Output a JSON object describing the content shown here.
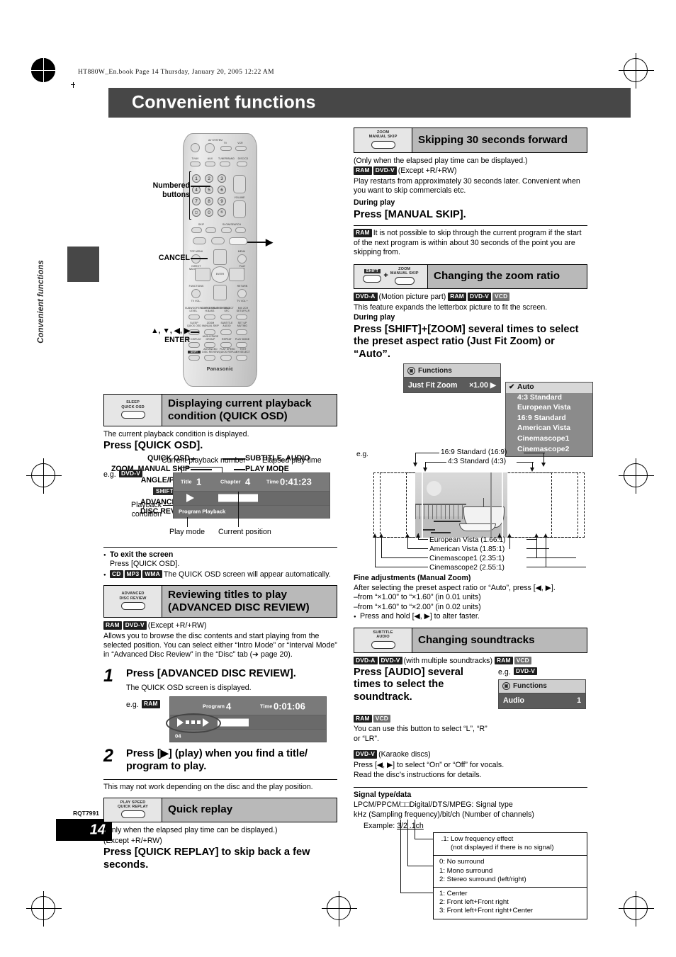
{
  "meta": {
    "book_info": "HT880W_En.book  Page 14  Thursday, January 20, 2005  12:22 AM",
    "chapter_title": "Convenient functions",
    "side_tab": "Convenient functions",
    "rqt_code": "RQT7991",
    "page_number": "14"
  },
  "remote": {
    "brand": "Panasonic",
    "callouts_left": [
      {
        "label": "Numbered\nbuttons",
        "line1": "Numbered",
        "line2": "buttons"
      },
      {
        "label": "CANCEL"
      },
      {
        "label": "▲, ▼, ◀, ▶",
        "line2": "ENTER"
      },
      {
        "label": "QUICK OSD"
      },
      {
        "label": "ZOOM, MANUAL SKIP"
      },
      {
        "label": "ANGLE/PAGE"
      },
      {
        "label": "SHIFT"
      },
      {
        "label": "ADVANCED",
        "line2": "DISC REVIEW"
      }
    ],
    "callouts_right": [
      {
        "label": "▶"
      },
      {
        "label": "SUBTITLE, AUDIO"
      },
      {
        "label": "PLAY MODE"
      },
      {
        "label": "REPEAT"
      },
      {
        "label": "PLAY SPEED,",
        "line2": "QUICK REPLAY"
      }
    ],
    "top_labels": {
      "av_system": "AV SYSTEM",
      "tv": "TV",
      "vcr": "VCR",
      "row2": [
        "TV/AV",
        "AUX",
        "TUNER/BAND",
        "DISC/CD"
      ],
      "ch": "CH",
      "volume": "VOLUME",
      "skip": "SKIP",
      "slow_search": "SLOW/SEARCH",
      "top_menu": "TOP MENU",
      "menu": "MENU",
      "direct_navigator": "DIRECT NAVIGATOR",
      "play_list": "PLAY LIST",
      "enter": "ENTER",
      "functions": "FUNCTIONS",
      "return": "RETURN",
      "tv_vol_minus": "TV VOL -",
      "tv_vol_plus": "TV VOL +"
    },
    "button_rows": [
      [
        "SUBWOOFER/SUPER SRND LEVEL",
        "C.FOCUS/SUPER SRND H.BASS",
        "CH SELECT SFC",
        "MIX 2CH SETUP/L,R"
      ],
      [
        "SLEEP QUICK OSD",
        "ZOOM MANUAL SKIP",
        "SUBTITLE AUDIO",
        "SET UP MUTING"
      ],
      [
        "FL DISPLAY",
        "ANGLE/PAGE GROUP",
        "REPEAT",
        "PLAY MODE"
      ],
      [
        "SHIFT",
        "ADVANCED DISC REVIEW",
        "PLAY SPEED QUICK REPLAY",
        "TEST CH SELECT"
      ]
    ]
  },
  "left_column": {
    "quick_osd": {
      "chip_line1": "SLEEP",
      "chip_line2": "QUICK OSD",
      "title": "Displaying current playback condition (QUICK OSD)",
      "intro": "The current playback condition is displayed.",
      "instruction": "Press [QUICK OSD].",
      "eg_label": "e.g.",
      "eg_badge": "DVD-V",
      "callout_top_left": "Current playback number",
      "callout_top_right": "Elapsed play time",
      "callout_left_l1": "Playback",
      "callout_left_l2": "condition",
      "callout_bottom_left": "Play mode",
      "callout_bottom_right": "Current position",
      "osd": {
        "title_label": "Title",
        "title_value": "1",
        "chapter_label": "Chapter",
        "chapter_value": "4",
        "time_label": "Time",
        "time_value": "0:41:23",
        "play_mode": "Program Playback"
      },
      "exit_heading": "To exit the screen",
      "exit_text": "Press [QUICK OSD].",
      "auto_badges": [
        "CD",
        "MP3",
        "WMA"
      ],
      "auto_text": "The QUICK OSD screen will appear automatically."
    },
    "advanced_disc_review": {
      "chip_line1": "ADVANCED",
      "chip_line2": "DISC REVIEW",
      "title": "Reviewing titles to play (ADVANCED DISC REVIEW)",
      "badges": [
        "RAM",
        "DVD-V"
      ],
      "badge_note": "(Except +R/+RW)",
      "desc": "Allows you to browse the disc contents and start playing from the selected position. You can select either “Intro Mode” or “Interval Mode” in “Advanced Disc Review” in the “Disc” tab (➔ page 20).",
      "step1_num": "1",
      "step1_text": "Press [ADVANCED DISC REVIEW].",
      "step1_sub": "The QUICK OSD screen is displayed.",
      "eg_label": "e.g.",
      "eg_badge": "RAM",
      "osd": {
        "program_label": "Program",
        "program_value": "4",
        "time_label": "Time",
        "time_value": "0:01:06",
        "chapter_small": "04"
      },
      "step2_num": "2",
      "step2_text": "Press [▶] (play) when you find a title/ program to play.",
      "footnote": "This may not work depending on the disc and the play position."
    },
    "quick_replay": {
      "chip_line1": "PLAY SPEED",
      "chip_line2": "QUICK REPLAY",
      "title": "Quick replay",
      "note1": "(Only when the elapsed play time can be displayed.)",
      "note2": "(Except +R/+RW)",
      "instruction": "Press [QUICK REPLAY] to skip back a few seconds."
    }
  },
  "right_column": {
    "manual_skip": {
      "chip_line1": "ZOOM",
      "chip_line2": "MANUAL SKIP",
      "title": "Skipping 30 seconds forward",
      "note1": "(Only when the elapsed play time can be displayed.)",
      "badges": [
        "RAM",
        "DVD-V"
      ],
      "badge_note": "(Except +R/+RW)",
      "desc": "Play restarts from approximately 30 seconds later. Convenient when you want to skip commercials etc.",
      "during_play": "During play",
      "instruction": "Press [MANUAL SKIP].",
      "footnote_badge": "RAM",
      "footnote": "It is not possible to skip through the current program if the start of the next program is within about 30 seconds of the point you are skipping from."
    },
    "zoom_ratio": {
      "chip_shift": "SHIFT",
      "chip_plus": "+",
      "chip_line1": "ZOOM",
      "chip_line2": "MANUAL SKIP",
      "title": "Changing the zoom ratio",
      "badge1": "DVD-A",
      "badge1_note": "(Motion picture part)",
      "badges": [
        "RAM",
        "DVD-V",
        "VCD"
      ],
      "desc": "This feature expands the letterbox picture to fit the screen.",
      "during_play": "During play",
      "instruction": "Press [SHIFT]+[ZOOM] several times to select the preset aspect ratio (Just Fit Zoom) or “Auto”.",
      "menu": {
        "header": "Functions",
        "row_label": "Just Fit Zoom",
        "row_value": "×1.00",
        "options": [
          "Auto",
          "4:3 Standard",
          "European Vista",
          "16:9 Standard",
          "American Vista",
          "Cinemascope1",
          "Cinemascope2"
        ],
        "selected": "Auto"
      },
      "diagram": {
        "eg_label": "e.g.",
        "top_labels": [
          "16:9 Standard (16:9)",
          "4:3 Standard (4:3)"
        ],
        "bottom_labels": [
          "European Vista (1.66:1)",
          "American Vista (1.85:1)",
          "Cinemascope1 (2.35:1)",
          "Cinemascope2 (2.55:1)"
        ]
      },
      "fine": {
        "heading": "Fine adjustments (Manual Zoom)",
        "line1": "After selecting the preset aspect ratio or “Auto”, press [◀, ▶].",
        "line2": "–from “×1.00” to “×1.60” (in 0.01 units)",
        "line3": "–from “×1.60” to “×2.00” (in 0.02 units)",
        "line4": "Press and hold [◀, ▶] to alter faster."
      }
    },
    "soundtracks": {
      "chip_line1": "SUBTITLE",
      "chip_line2": "AUDIO",
      "title": "Changing soundtracks",
      "badges_a": [
        "DVD-A",
        "DVD-V"
      ],
      "badge_note": "(with multiple soundtracks)",
      "badges_b": [
        "RAM",
        "VCD"
      ],
      "instruction": "Press [AUDIO] several times to select the soundtrack.",
      "eg_label": "e.g.",
      "eg_badge": "DVD-V",
      "menu": {
        "header": "Functions",
        "row_label": "Audio",
        "row_value": "1"
      },
      "ram_vcd_badges": [
        "RAM",
        "VCD"
      ],
      "ram_vcd_text": "You can use this button to select “L”, “R” or “LR”.",
      "karaoke_badge": "DVD-V",
      "karaoke_note": "(Karaoke discs)",
      "karaoke_l1": "Press [◀, ▶] to select “On” or “Off” for vocals.",
      "karaoke_l2": "Read the disc’s instructions for details."
    },
    "signal": {
      "heading": "Signal type/data",
      "line1": "LPCM/PPCM/□□Digital/DTS/MPEG:  Signal type",
      "line2": "kHz (Sampling frequency)/bit/ch (Number of channels)",
      "example_label": "Example:",
      "example_value": "3/2 .1ch",
      "table": [
        [
          " .1:  Low frequency effect",
          "(not displayed if there is no signal)"
        ],
        [
          "0:  No surround",
          "1:  Mono surround",
          "2:  Stereo surround (left/right)"
        ],
        [
          "1:  Center",
          "2:  Front left+Front right",
          "3:  Front left+Front right+Center"
        ]
      ]
    }
  }
}
